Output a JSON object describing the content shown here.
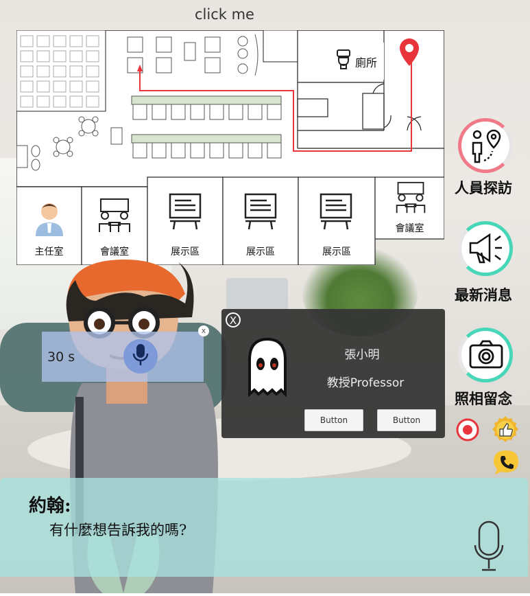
{
  "header": {
    "click_label": "click me"
  },
  "map": {
    "restroom_label": "廁所",
    "rooms": [
      {
        "label": "主任室"
      },
      {
        "label": "會議室"
      },
      {
        "label": "展示區"
      },
      {
        "label": "展示區"
      },
      {
        "label": "展示區"
      },
      {
        "label": "會議室"
      }
    ],
    "route_color": "#e8343b",
    "pin_color": "#e8343b"
  },
  "recorder": {
    "time": "30 s",
    "close_symbol": "x"
  },
  "profile_card": {
    "close_symbol": "X",
    "name": "張小明",
    "title": "教授Professor",
    "button1": "Button",
    "button2": "Button"
  },
  "side_menu": {
    "items": [
      {
        "label": "人員探訪",
        "icon": "person-location-icon",
        "ring_color": "#f07a8a"
      },
      {
        "label": "最新消息",
        "icon": "megaphone-icon",
        "ring_color": "#47d6b7"
      },
      {
        "label": "照相留念",
        "icon": "camera-icon",
        "ring_color": "#47d6b7"
      }
    ],
    "small_icons": [
      "record-icon",
      "thumbs-up-badge-icon",
      "phone-icon"
    ]
  },
  "dialog": {
    "speaker": "約翰:",
    "message": "有什麼想告訴我的嗎?"
  }
}
